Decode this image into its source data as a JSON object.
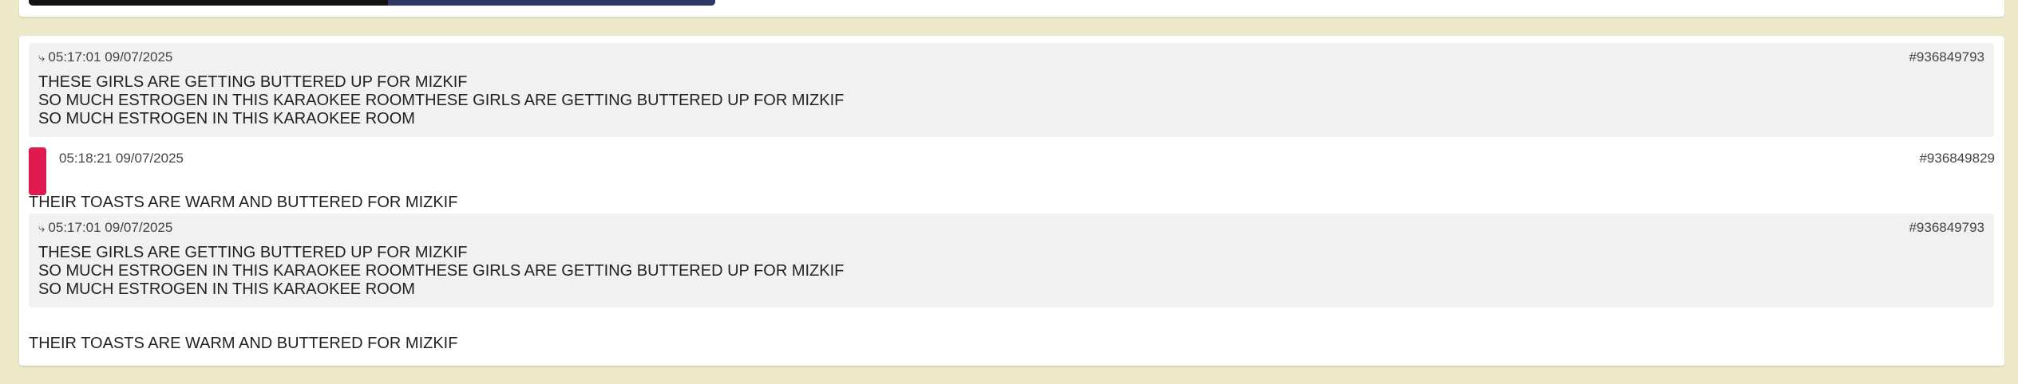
{
  "quoted_post": {
    "time": "05:17:01 09/07/2025",
    "id": "#936849793",
    "lines": [
      "THESE GIRLS ARE GETTING BUTTERED UP FOR MIZKIF",
      "SO MUCH ESTROGEN IN THIS KARAOKEE ROOMTHESE GIRLS ARE GETTING BUTTERED UP FOR MIZKIF",
      "SO MUCH ESTROGEN IN THIS KARAOKEE ROOM"
    ]
  },
  "post": {
    "time": "05:18:21 09/07/2025",
    "id": "#936849829",
    "text": "THEIR TOASTS ARE WARM AND BUTTERED FOR MIZKIF",
    "avatar_color": "#e01a4f"
  },
  "quoted_post_2": {
    "time": "05:17:01 09/07/2025",
    "id": "#936849793",
    "lines": [
      "THESE GIRLS ARE GETTING BUTTERED UP FOR MIZKIF",
      "SO MUCH ESTROGEN IN THIS KARAOKEE ROOMTHESE GIRLS ARE GETTING BUTTERED UP FOR MIZKIF",
      "SO MUCH ESTROGEN IN THIS KARAOKEE ROOM"
    ]
  },
  "post_text_repeat": "THEIR TOASTS ARE WARM AND BUTTERED FOR MIZKIF",
  "icons": {
    "reply_arrow": "reply-arrow-icon"
  }
}
